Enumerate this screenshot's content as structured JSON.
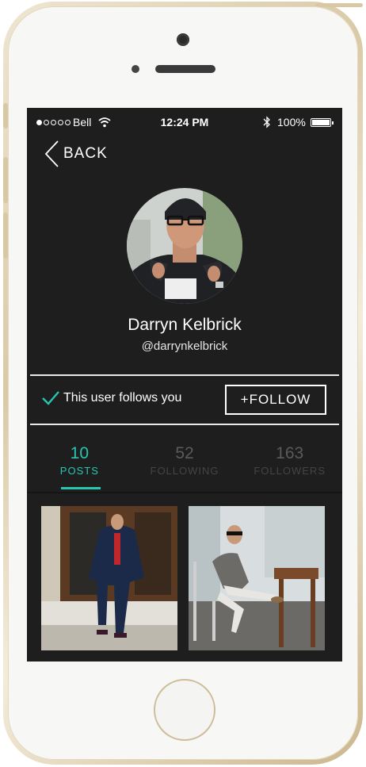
{
  "status_bar": {
    "signal_dots_filled": 1,
    "signal_dots_total": 5,
    "carrier": "Bell",
    "wifi_icon": "wifi-icon",
    "time": "12:24 PM",
    "bluetooth_icon": "bluetooth-icon",
    "battery_percent": "100%",
    "battery_level": 1.0
  },
  "nav": {
    "back_label": "BACK",
    "back_icon": "chevron-left-icon"
  },
  "profile": {
    "name": "Darryn Kelbrick",
    "handle": "@darrynkelbrick"
  },
  "relationship": {
    "follows_you_text": "This user follows you",
    "check_icon": "checkmark-icon",
    "follow_button_label": "+FOLLOW"
  },
  "stats": [
    {
      "count": "10",
      "label": "POSTS",
      "active": true
    },
    {
      "count": "52",
      "label": "FOLLOWING",
      "active": false
    },
    {
      "count": "163",
      "label": "FOLLOWERS",
      "active": false
    }
  ],
  "colors": {
    "accent": "#27c6b0",
    "screen_background": "#1e1e1e",
    "inactive_text": "#5a5a5a"
  }
}
